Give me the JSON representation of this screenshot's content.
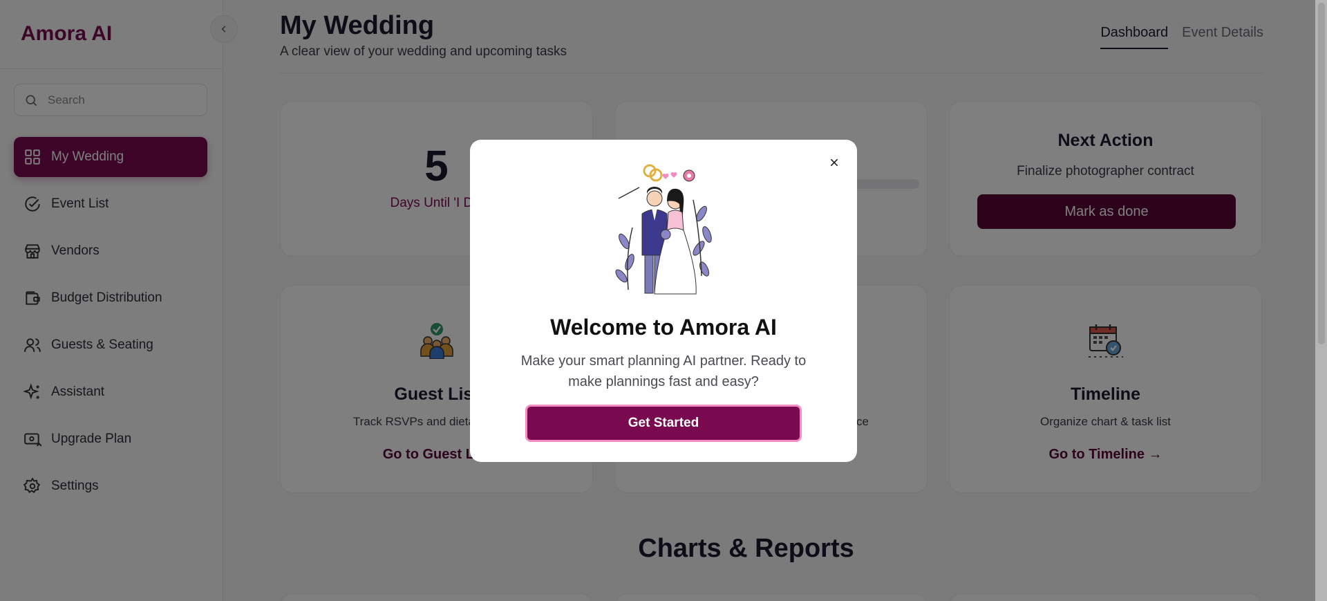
{
  "app": {
    "logo": "Amora AI"
  },
  "sidebar": {
    "search_placeholder": "Search",
    "items": [
      {
        "label": "My Wedding",
        "icon": "grid-icon"
      },
      {
        "label": "Event List",
        "icon": "check-circle-icon"
      },
      {
        "label": "Vendors",
        "icon": "store-icon"
      },
      {
        "label": "Budget Distribution",
        "icon": "wallet-icon"
      },
      {
        "label": "Guests & Seating",
        "icon": "users-icon"
      },
      {
        "label": "Assistant",
        "icon": "sparkles-icon"
      },
      {
        "label": "Upgrade Plan",
        "icon": "upgrade-icon"
      },
      {
        "label": "Settings",
        "icon": "gear-icon"
      }
    ]
  },
  "header": {
    "title": "My Wedding",
    "subtitle": "A clear view of your wedding and upcoming tasks",
    "tabs": [
      "Dashboard",
      "Event Details"
    ]
  },
  "cards": {
    "countdown": {
      "value": "5",
      "label": "Days Until 'I Do'"
    },
    "next_action": {
      "title": "Next Action",
      "text": "Finalize photographer contract",
      "button": "Mark as done"
    },
    "guest_list": {
      "title": "Guest List",
      "desc": "Track RSVPs and dietary needs",
      "link": "Go to Guest List"
    },
    "middle": {
      "desc_fragment": "ce"
    },
    "timeline": {
      "title": "Timeline",
      "desc": "Organize chart & task list",
      "link": "Go to Timeline"
    }
  },
  "section": {
    "title": "Charts & Reports"
  },
  "modal": {
    "title": "Welcome to Amora AI",
    "text": "Make your smart planning AI partner. Ready to make plannings fast and easy?",
    "button": "Get Started"
  },
  "colors": {
    "brand": "#7a0a4f",
    "brand_dark": "#5a0639",
    "accent_border": "#f28cc4"
  }
}
